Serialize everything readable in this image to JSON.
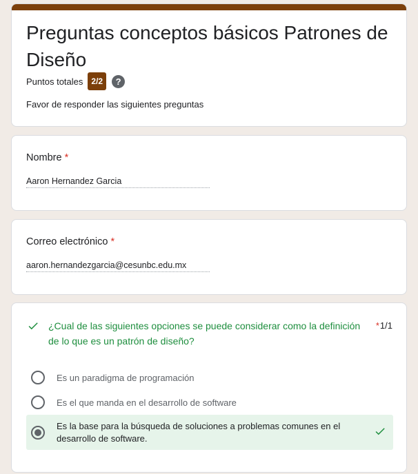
{
  "form": {
    "title": "Preguntas conceptos básicos Patrones de Diseño",
    "score_label": "Puntos totales",
    "score_value": "2/2",
    "description": "Favor de responder las siguientes preguntas"
  },
  "fields": [
    {
      "label": "Nombre",
      "required_mark": "*",
      "value": "Aaron Hernandez Garcia"
    },
    {
      "label": "Correo electrónico",
      "required_mark": "*",
      "value": "aaron.hernandezgarcia@cesunbc.edu.mx"
    }
  ],
  "question": {
    "text": "¿Cual de las siguientes opciones se puede considerar como la definición de lo que es un patrón de diseño?",
    "required_mark": "*",
    "score": "1/1",
    "options": [
      {
        "label": "Es un paradigma de programación",
        "selected": false
      },
      {
        "label": "Es el que manda en el desarrollo de software",
        "selected": false
      },
      {
        "label": "Es la base para la búsqueda de soluciones a problemas comunes en el desarrollo de software.",
        "selected": true,
        "correct": true
      }
    ]
  },
  "colors": {
    "accent": "#7c3f0a",
    "background": "#f1ebe6",
    "correct_green": "#1e8e3e",
    "correct_bg": "#e6f4ea",
    "required_red": "#d93025"
  },
  "icons": {
    "help": "help-icon",
    "question_status": "check-icon",
    "answer_status": "check-icon"
  }
}
